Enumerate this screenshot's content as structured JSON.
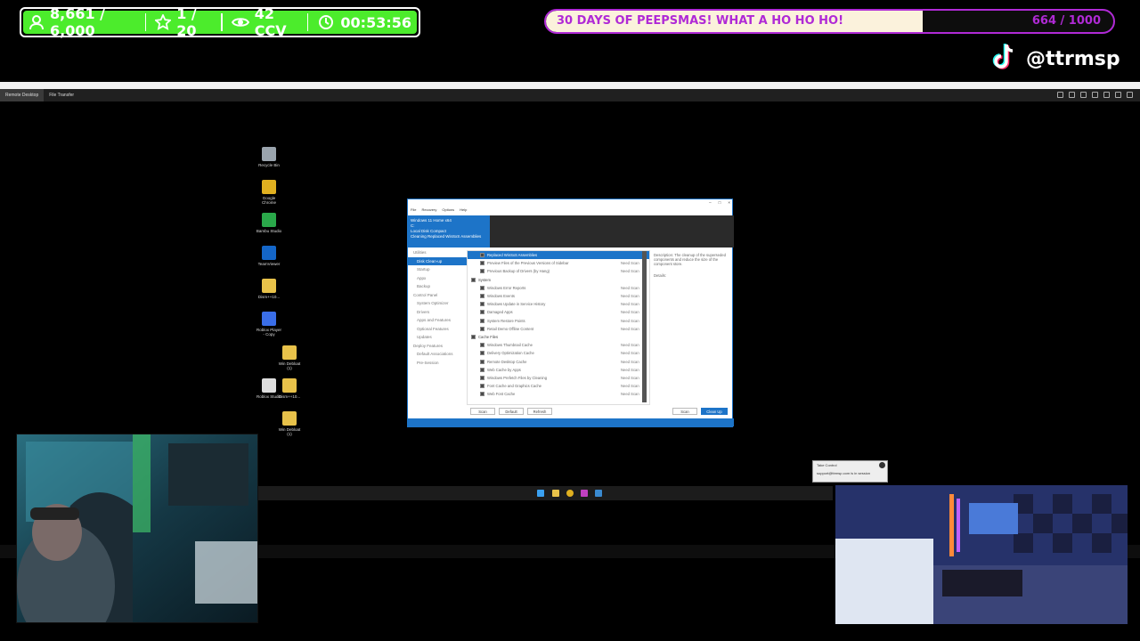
{
  "overlay": {
    "followers": "8,661 / 6,000",
    "subs": "1 / 20",
    "viewers": "42 CCV",
    "timer": "00:53:56",
    "goal_title": "30 DAYS OF PEEPSMAS! WHAT A HO HO HO!",
    "goal_count": "664 / 1000",
    "goal_progress": 0.664,
    "tiktok_handle": "@ttrmsp",
    "accent_green": "#4cec2c",
    "accent_purple": "#b02ad6"
  },
  "remote": {
    "tabs": [
      "Remote Desktop",
      "File Transfer"
    ]
  },
  "desktop_icons": [
    {
      "label": "Recycle Bin",
      "color": "#9aa4ad"
    },
    {
      "label": "Google Chrome",
      "color": "#e0b020"
    },
    {
      "label": "Bambu Studio",
      "color": "#2aa84a"
    },
    {
      "label": "TeamViewer",
      "color": "#1466c8"
    },
    {
      "label": "Dism++10...",
      "color": "#e8c24a"
    },
    {
      "label": "Roblox Player - Copy",
      "color": "#3a6ee8"
    },
    {
      "label": "Win Debloat (1)",
      "color": "#e8c24a"
    },
    {
      "label": "Roblox Studio",
      "color": "#ddd"
    },
    {
      "label": "Dism++10...",
      "color": "#e8c24a"
    },
    {
      "label": "Win Debloat (1)",
      "color": "#e8c24a"
    }
  ],
  "app": {
    "header": [
      "Windows 11 Home x64",
      "C:",
      "Local Disk Compact",
      "Cleaning Replaced WinSxS Assemblies"
    ],
    "menu": [
      "File",
      "Recovery",
      "Options",
      "Help"
    ],
    "nav": [
      {
        "label": "Utilities",
        "sub": false,
        "sel": false
      },
      {
        "label": "Disk Clean-up",
        "sub": true,
        "sel": true
      },
      {
        "label": "Startup",
        "sub": true,
        "sel": false
      },
      {
        "label": "Appx",
        "sub": true,
        "sel": false
      },
      {
        "label": "Backup",
        "sub": true,
        "sel": false
      },
      {
        "label": "Control Panel",
        "sub": false,
        "sel": false
      },
      {
        "label": "System Optimizer",
        "sub": true,
        "sel": false
      },
      {
        "label": "Drivers",
        "sub": true,
        "sel": false
      },
      {
        "label": "Apps and Features",
        "sub": true,
        "sel": false
      },
      {
        "label": "Optional Features",
        "sub": true,
        "sel": false
      },
      {
        "label": "Updates",
        "sub": true,
        "sel": false
      },
      {
        "label": "Deploy Features",
        "sub": false,
        "sel": false
      },
      {
        "label": "Default Associations",
        "sub": true,
        "sel": false
      },
      {
        "label": "Pre-Session",
        "sub": true,
        "sel": false
      }
    ],
    "rows": [
      {
        "label": "Replaced WinSxS Assemblies",
        "size": "",
        "sel": true,
        "group": false,
        "on": true
      },
      {
        "label": "Preview Files of the Previous Versions of Sidebar",
        "size": "Need Scan",
        "sel": false,
        "group": false,
        "on": true
      },
      {
        "label": "Previous Backup of Drivers (by Hang)",
        "size": "Need Scan",
        "sel": false,
        "group": false,
        "on": true
      },
      {
        "label": "System",
        "size": "",
        "sel": false,
        "group": true,
        "on": true
      },
      {
        "label": "Windows Error Reports",
        "size": "Need Scan",
        "sel": false,
        "group": false,
        "on": true
      },
      {
        "label": "Windows Events",
        "size": "Need Scan",
        "sel": false,
        "group": false,
        "on": true
      },
      {
        "label": "Windows Update in Service History",
        "size": "Need Scan",
        "sel": false,
        "group": false,
        "on": true
      },
      {
        "label": "Damaged Apps",
        "size": "Need Scan",
        "sel": false,
        "group": false,
        "on": true
      },
      {
        "label": "System Restore Points",
        "size": "Need Scan",
        "sel": false,
        "group": false,
        "on": true
      },
      {
        "label": "Retail Demo Offline Content",
        "size": "Need Scan",
        "sel": false,
        "group": false,
        "on": true
      },
      {
        "label": "Cache Files",
        "size": "",
        "sel": false,
        "group": true,
        "on": true
      },
      {
        "label": "Windows Thumbnail Cache",
        "size": "Need Scan",
        "sel": false,
        "group": false,
        "on": true
      },
      {
        "label": "Delivery Optimization Cache",
        "size": "Need Scan",
        "sel": false,
        "group": false,
        "on": true
      },
      {
        "label": "Remote Desktop Cache",
        "size": "Need Scan",
        "sel": false,
        "group": false,
        "on": true
      },
      {
        "label": "Web Cache by Apps",
        "size": "Need Scan",
        "sel": false,
        "group": false,
        "on": true
      },
      {
        "label": "Windows Prefetch Files by Cleaning",
        "size": "Need Scan",
        "sel": false,
        "group": false,
        "on": true
      },
      {
        "label": "Font Cache and Graphics Cache",
        "size": "Need Scan",
        "sel": false,
        "group": false,
        "on": true
      },
      {
        "label": "Web Font Cache",
        "size": "Need Scan",
        "sel": false,
        "group": false,
        "on": true
      }
    ],
    "description": "Description: The cleanup of the superseded components and reduce the size of the component store.",
    "desc_extra": "Details:",
    "buttons": {
      "scan_left": "Scan",
      "default": "Default",
      "refresh": "Refresh",
      "scan": "Scan",
      "cleanup": "Clean Up"
    }
  },
  "notification": {
    "title": "Take Control",
    "body": "support@ttrmsp.com is in session"
  }
}
